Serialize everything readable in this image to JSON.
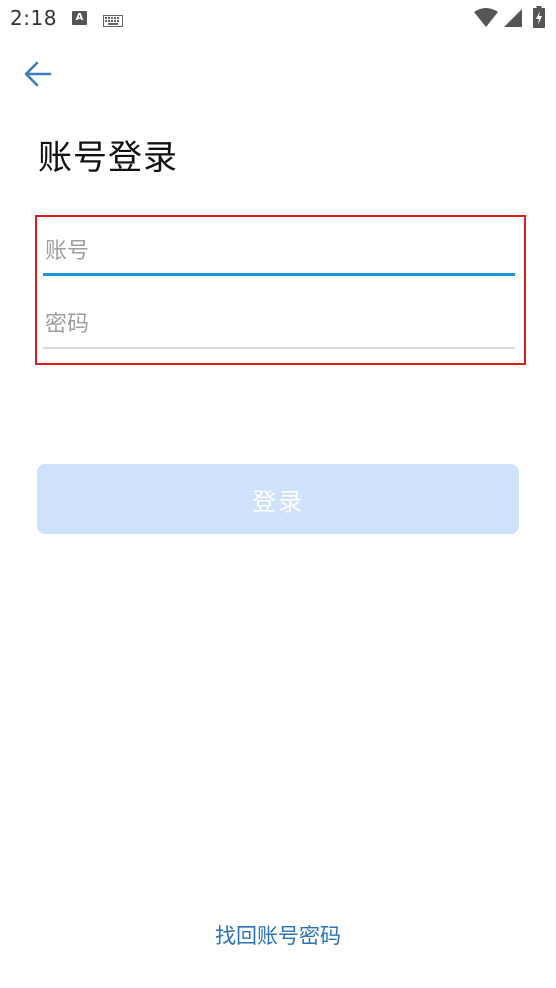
{
  "status_bar": {
    "time": "2:18",
    "notification_icon_a": "A"
  },
  "header": {
    "back_icon": "arrow-left-icon"
  },
  "page": {
    "title": "账号登录"
  },
  "form": {
    "account_placeholder": "账号",
    "account_value": "",
    "password_placeholder": "密码",
    "password_value": ""
  },
  "actions": {
    "login_label": "登录",
    "recover_link": "找回账号密码"
  },
  "colors": {
    "accent": "#1a96d9",
    "button_disabled": "#cfe2fb",
    "link": "#2b73b7",
    "highlight_border": "#dd1c1c"
  }
}
